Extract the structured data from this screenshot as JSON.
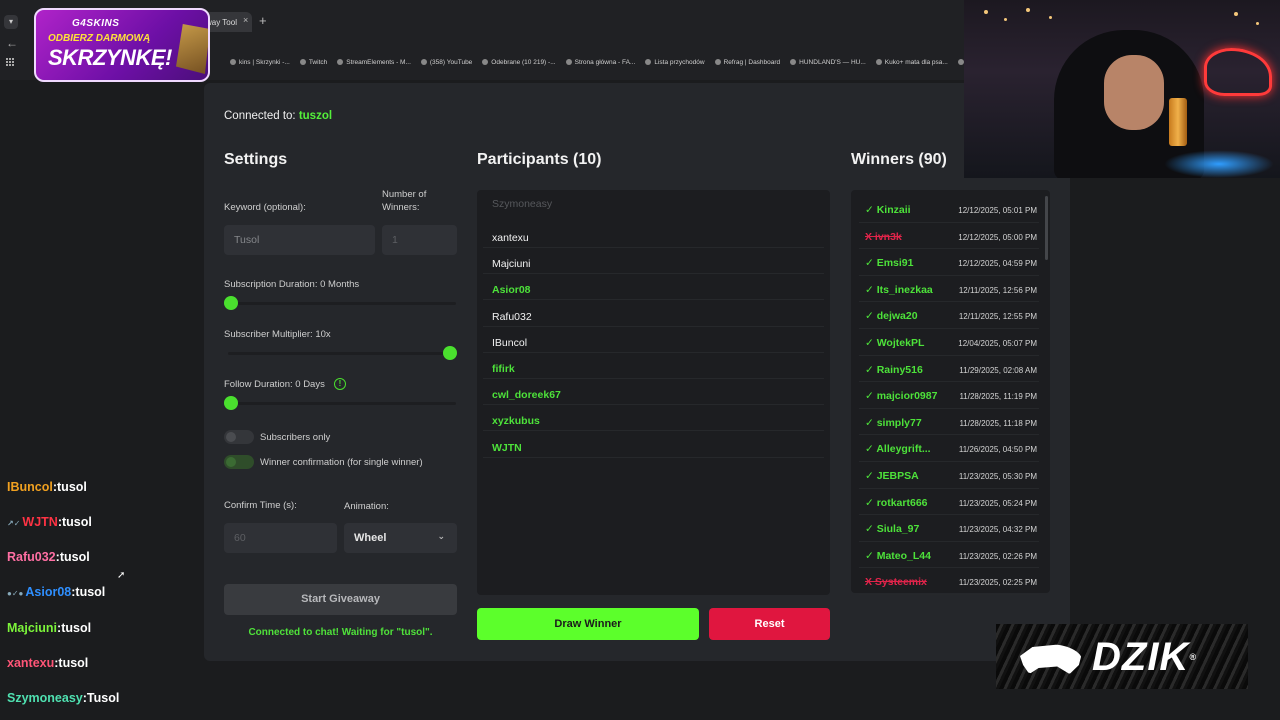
{
  "browser": {
    "active_tab_label": "way Tool",
    "tab_close": "×",
    "tab_new": "+",
    "back": "←",
    "bookmarks": [
      "kins | Skrzynki -...",
      "Twitch",
      "StreamElements - M...",
      "(358) YouTube",
      "Odebrane (10 219) -...",
      "Strona główna - FA...",
      "Lista przychodów",
      "Refrag | Dashboard",
      "HUNDLAND'S — HU...",
      "Kuko+ mata dla psa...",
      "Reborn + The Ho"
    ]
  },
  "ad": {
    "brand": "G4SKINS",
    "line1": "ODBIERZ DARMOWĄ",
    "line2": "SKRZYNKĘ!"
  },
  "chat": [
    {
      "user": "IBuncol",
      "sep": ":",
      "msg": "tusol",
      "color": "#f0a020",
      "badges": ""
    },
    {
      "user": "WJTN",
      "sep": ":",
      "msg": "tusol",
      "color": "#ff3344",
      "badges": "↗✓"
    },
    {
      "user": "Rafu032",
      "sep": ":",
      "msg": "tusol",
      "color": "#ff6fa3",
      "badges": ""
    },
    {
      "user": "Asior08",
      "sep": ":",
      "msg": "tusol",
      "color": "#2f8fff",
      "badges": "●✓●"
    },
    {
      "user": "Majciuni",
      "sep": ":",
      "msg": "tusol",
      "color": "#7cf43a",
      "badges": ""
    },
    {
      "user": "xantexu",
      "sep": ":",
      "msg": "tusol",
      "color": "#ff5577",
      "badges": ""
    },
    {
      "user": "Szymoneasy",
      "sep": ":",
      "msg": "Tusol",
      "color": "#4fe0b0",
      "badges": ""
    }
  ],
  "app": {
    "connected_prefix": "Connected to: ",
    "connected_channel": "tuszol",
    "settings_title": "Settings",
    "participants_title": "Participants (10)",
    "winners_title": "Winners (90)",
    "keyword_label": "Keyword (optional):",
    "keyword_value": "Tusol",
    "num_winners_label": "Number of Winners:",
    "num_winners_placeholder": "1",
    "sub_duration_label": "Subscription Duration: 0 Months",
    "sub_duration_value": 0,
    "sub_multiplier_label": "Subscriber Multiplier: 10x",
    "sub_multiplier_value": 10,
    "follow_duration_label": "Follow Duration: 0 Days",
    "follow_duration_value": 0,
    "info_icon": "!",
    "subscribers_only_label": "Subscribers only",
    "winner_confirmation_label": "Winner confirmation (for single winner)",
    "confirm_time_label": "Confirm Time (s):",
    "confirm_time_placeholder": "60",
    "animation_label": "Animation:",
    "animation_value": "Wheel",
    "chevron": "⌄",
    "start_button": "Start Giveaway",
    "status_text": "Connected to chat! Waiting for \"tusol\".",
    "draw_button": "Draw Winner",
    "reset_button": "Reset"
  },
  "participants": [
    {
      "name": "Szymoneasy",
      "color": "#56585c"
    },
    {
      "name": "xantexu",
      "color": "#f2f2f2"
    },
    {
      "name": "Majciuni",
      "color": "#f2f2f2"
    },
    {
      "name": "Asior08",
      "color": "#4de23a"
    },
    {
      "name": "Rafu032",
      "color": "#f2f2f2"
    },
    {
      "name": "IBuncol",
      "color": "#f2f2f2"
    },
    {
      "name": "fifirk",
      "color": "#4de23a"
    },
    {
      "name": "cwl_doreek67",
      "color": "#4de23a"
    },
    {
      "name": "xyzkubus",
      "color": "#4de23a"
    },
    {
      "name": "WJTN",
      "color": "#4de23a"
    }
  ],
  "winners": [
    {
      "name": "✓ Kinzaii",
      "date": "12/12/2025, 05:01 PM",
      "failed": false
    },
    {
      "name": "X ivn3k",
      "date": "12/12/2025, 05:00 PM",
      "failed": true
    },
    {
      "name": "✓ Emsi91",
      "date": "12/12/2025, 04:59 PM",
      "failed": false
    },
    {
      "name": "✓ Its_inezkaa",
      "date": "12/11/2025, 12:56 PM",
      "failed": false
    },
    {
      "name": "✓ dejwa20",
      "date": "12/11/2025, 12:55 PM",
      "failed": false
    },
    {
      "name": "✓ WojtekPL",
      "date": "12/04/2025, 05:07 PM",
      "failed": false
    },
    {
      "name": "✓ Rainy516",
      "date": "11/29/2025, 02:08 AM",
      "failed": false
    },
    {
      "name": "✓ majcior0987",
      "date": "11/28/2025, 11:19 PM",
      "failed": false
    },
    {
      "name": "✓ simply77",
      "date": "11/28/2025, 11:18 PM",
      "failed": false
    },
    {
      "name": "✓ Alleygrift...",
      "date": "11/26/2025, 04:50 PM",
      "failed": false
    },
    {
      "name": "✓ JEBPSA",
      "date": "11/23/2025, 05:30 PM",
      "failed": false
    },
    {
      "name": "✓ rotkart666",
      "date": "11/23/2025, 05:24 PM",
      "failed": false
    },
    {
      "name": "✓ Siula_97",
      "date": "11/23/2025, 04:32 PM",
      "failed": false
    },
    {
      "name": "✓ Mateo_L44",
      "date": "11/23/2025, 02:26 PM",
      "failed": false
    },
    {
      "name": "X Systeemix",
      "date": "11/23/2025, 02:25 PM",
      "failed": true
    }
  ],
  "logo": {
    "text": "DZIK",
    "mark": "®"
  }
}
